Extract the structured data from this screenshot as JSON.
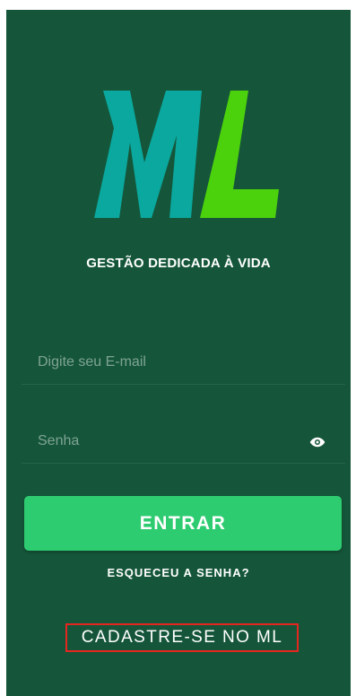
{
  "logo": {
    "text": "ML",
    "colors": {
      "m": "#0aa89e",
      "l": "#4cd20c"
    }
  },
  "tagline": "GESTÃO DEDICADA À VIDA",
  "login_form": {
    "email_placeholder": "Digite seu E-mail",
    "email_value": "",
    "password_placeholder": "Senha",
    "password_value": "",
    "password_toggle_icon": "eye-icon"
  },
  "actions": {
    "enter_label": "ENTRAR",
    "forgot_label": "ESQUECEU A SENHA?",
    "signup_label": "CADASTRE-SE NO ML"
  },
  "colors": {
    "background": "#15563a",
    "button": "#2ecc71",
    "highlight_border": "#e52620"
  }
}
